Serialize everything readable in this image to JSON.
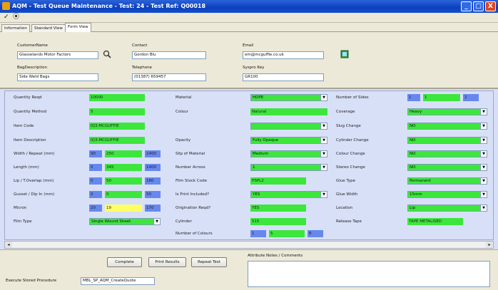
{
  "window": {
    "title": "AQM - Test Queue Maintenance - Test: 24 - Test Ref: Q00018",
    "minimize": "_",
    "maximize": "□",
    "close": "X"
  },
  "toolbar": {
    "check": "✓",
    "record": "⦿"
  },
  "tabs": [
    "Information",
    "Standard View",
    "Form View"
  ],
  "header": {
    "customer_label": "CustomerName",
    "customer_value": "Glasselands Motor Factors",
    "contact_label": "Contact",
    "contact_value": "Gordon Blu",
    "email_label": "Email",
    "email_value": "em@mcguffie.co.uk",
    "bag_label": "BagDescription",
    "bag_value": "Side Weld Bags",
    "telephone_label": "Telephone",
    "telephone_value": "(01387) 659457",
    "syspro_label": "Syspro Key",
    "syspro_value": "GR100"
  },
  "form": {
    "col1": [
      {
        "label": "Quantity Reqd",
        "values": [
          "10000"
        ]
      },
      {
        "label": "Quantity Method",
        "values": [
          "5"
        ]
      },
      {
        "label": "Item Code",
        "values": [
          "IQ3-MCGUFFIE"
        ]
      },
      {
        "label": "Item Description",
        "values": [
          "IQ3-MCGUFFIE"
        ]
      },
      {
        "label": "Width / Repeat (mm)",
        "values": [
          "90",
          "250",
          "1400"
        ]
      },
      {
        "label": "Length (mm)",
        "values": [
          "0",
          "345",
          "1400"
        ]
      },
      {
        "label": "Lip / T.Overlap (mm)",
        "values": [
          "0",
          "50",
          "180"
        ]
      },
      {
        "label": "Gusset / Dip In (mm)",
        "values": [
          "0",
          "0",
          "50"
        ]
      },
      {
        "label": "Micron",
        "values": [
          "20",
          "19",
          "170"
        ]
      },
      {
        "label": "Film Type",
        "values": [
          "Single Wound Sheet"
        ]
      }
    ],
    "col2": [
      {
        "label": "Material",
        "value": "HDPE"
      },
      {
        "label": "Colour",
        "value": "Natural"
      },
      {
        "label": "",
        "value": ""
      },
      {
        "label": "Opacity",
        "value": "Fully Opaque"
      },
      {
        "label": "Slip of Material",
        "value": "Medium"
      },
      {
        "label": "Number Across",
        "value": "1"
      },
      {
        "label": "Film Stock Code",
        "value": "PSPL2"
      },
      {
        "label": "Is Print Included?",
        "value": "YES"
      },
      {
        "label": "Origination Reqd?",
        "value": "YES"
      },
      {
        "label": "Cylinder",
        "value": "515"
      },
      {
        "label": "Number of Colours",
        "values": [
          "1",
          "5",
          "8"
        ]
      }
    ],
    "col3": [
      {
        "label": "Number of Sides",
        "values": [
          "1",
          "1",
          "2"
        ]
      },
      {
        "label": "Coverage",
        "value": "Heavy"
      },
      {
        "label": "Slug Change",
        "value": "NO"
      },
      {
        "label": "Cylinder Change",
        "value": "NO"
      },
      {
        "label": "Colour Change",
        "value": "NO"
      },
      {
        "label": "Stereo Change",
        "value": "NO"
      },
      {
        "label": "Glue Type",
        "value": "Permanent"
      },
      {
        "label": "Glue Width",
        "value": "15mm"
      },
      {
        "label": "Location",
        "value": "Lip"
      },
      {
        "label": "Release Tape",
        "value": "TAPE METALISED"
      }
    ]
  },
  "buttons": {
    "complete": "Complete",
    "print": "Print Results",
    "repeat": "Repeat Test"
  },
  "procedure": {
    "label": "Execute Stored Procedure",
    "value": "MBL_SP_AQM_CreateQuote"
  },
  "notes_label": "Attribute Notes / Comments",
  "colors": {
    "green": "#3de63d",
    "blue": "#6688ee",
    "yellow": "#ffff66",
    "title_bar": "#0a3fbf"
  }
}
